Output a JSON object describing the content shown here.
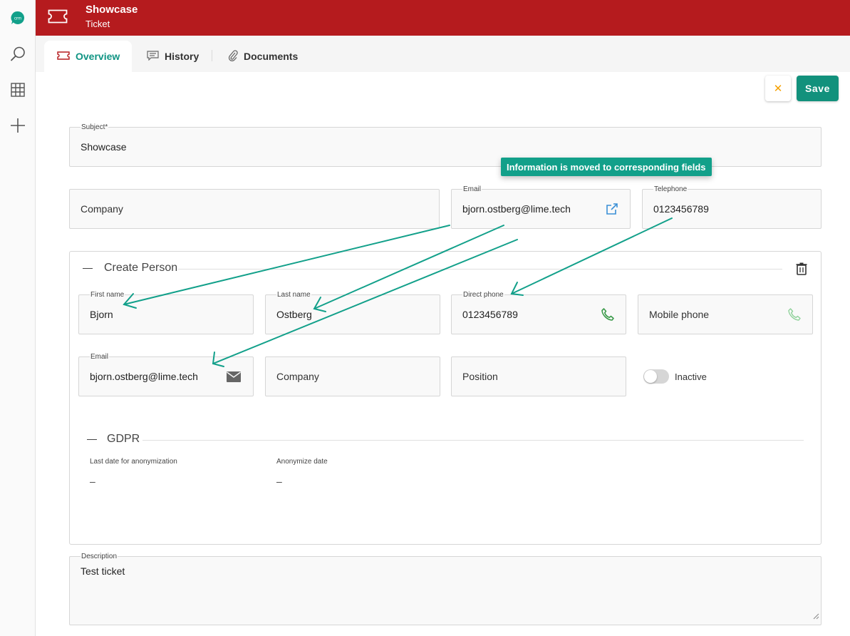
{
  "header": {
    "title": "Showcase",
    "subtitle": "Ticket"
  },
  "tabs": [
    {
      "label": "Overview",
      "icon": "ticket-icon",
      "active": true
    },
    {
      "label": "History",
      "icon": "history-icon",
      "active": false
    },
    {
      "label": "Documents",
      "icon": "paperclip-icon",
      "active": false
    }
  ],
  "actions": {
    "save_label": "Save",
    "cancel_glyph": "✕"
  },
  "fields": {
    "subject": {
      "label": "Subject*",
      "value": "Showcase"
    },
    "company": {
      "placeholder": "Company"
    },
    "email": {
      "label": "Email",
      "value": "bjorn.ostberg@lime.tech"
    },
    "telephone": {
      "label": "Telephone",
      "value": "0123456789"
    }
  },
  "callout": "Information is moved to corresponding fields",
  "create_person": {
    "title": "Create Person",
    "first_name": {
      "label": "First name",
      "value": "Bjorn"
    },
    "last_name": {
      "label": "Last name",
      "value": "Ostberg"
    },
    "direct_phone": {
      "label": "Direct phone",
      "value": "0123456789"
    },
    "mobile_phone": {
      "placeholder": "Mobile phone"
    },
    "email": {
      "label": "Email",
      "value": "bjorn.ostberg@lime.tech"
    },
    "company": {
      "placeholder": "Company"
    },
    "position": {
      "placeholder": "Position"
    },
    "inactive": {
      "label": "Inactive",
      "checked": false
    },
    "gdpr": {
      "title": "GDPR",
      "last_date_label": "Last date for anonymization",
      "last_date_value": "–",
      "anonymize_label": "Anonymize date",
      "anonymize_value": "–"
    }
  },
  "description": {
    "label": "Description",
    "value": "Test ticket"
  },
  "colors": {
    "brand": "#b51b1e",
    "accent": "#12917c",
    "callout": "#12a08a",
    "phone_icon": "#3b9a4a",
    "cancel_icon": "#f5a000"
  }
}
